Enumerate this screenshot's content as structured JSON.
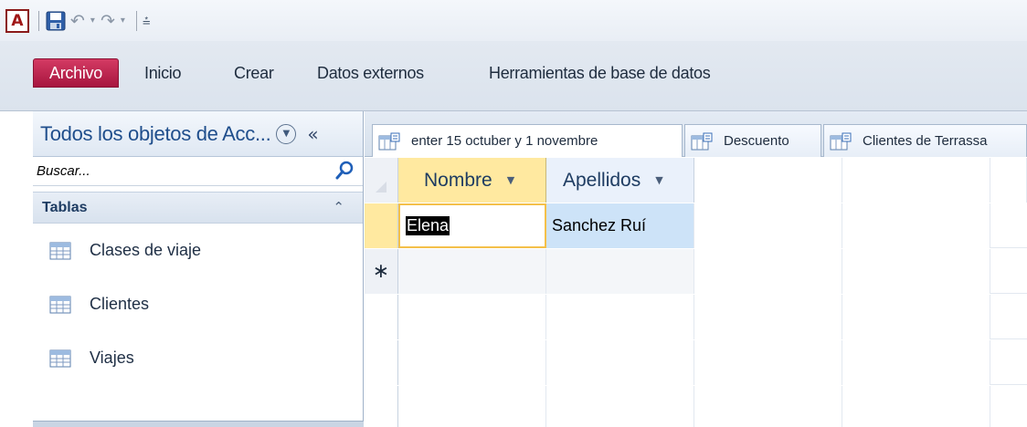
{
  "quick_access": {
    "app_icon": "A",
    "undo_icon": "undo-icon",
    "redo_icon": "redo-icon",
    "dropdown_glyph": "▾",
    "customize_glyph": "⩮"
  },
  "ribbon": {
    "tabs": [
      {
        "label": "Archivo",
        "active": true
      },
      {
        "label": "Inicio"
      },
      {
        "label": "Crear"
      },
      {
        "label": "Datos externos"
      },
      {
        "label": "Herramientas de base de datos"
      }
    ]
  },
  "nav_pane": {
    "title": "Todos los objetos de Acc...",
    "search_placeholder": "Buscar...",
    "group_label": "Tablas",
    "items": [
      {
        "label": "Clases de viaje"
      },
      {
        "label": "Clientes"
      },
      {
        "label": "Viajes"
      }
    ]
  },
  "doc_tabs": [
    {
      "label": "enter 15 octuber y 1 novembre"
    },
    {
      "label": "Descuento"
    },
    {
      "label": "Clientes de Terrassa"
    }
  ],
  "datasheet": {
    "columns": [
      {
        "label": "Nombre"
      },
      {
        "label": "Apellidos"
      }
    ],
    "rows": [
      {
        "nombre": "Elena",
        "apellidos": "Sanchez Ruí"
      }
    ],
    "new_record_marker": "∗"
  },
  "colors": {
    "archivo_tab": "#b8224e",
    "selected_header": "#ffe9a0",
    "selected_cell": "#cde3f8"
  }
}
